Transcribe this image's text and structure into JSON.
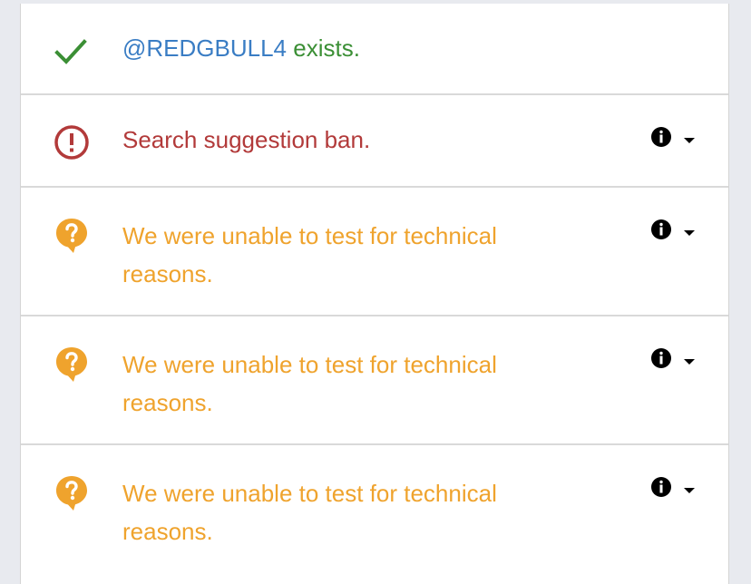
{
  "colors": {
    "success": "#3b8f35",
    "link": "#3a7dc4",
    "error": "#b23a3a",
    "warning": "#efa32d",
    "icon_dark": "#000000"
  },
  "results": [
    {
      "status": "success",
      "icon": "check-icon",
      "handle": "@REDGBULL4",
      "message": " exists.",
      "has_info": false
    },
    {
      "status": "error",
      "icon": "exclamation-circle-icon",
      "message": "Search suggestion ban.",
      "has_info": true
    },
    {
      "status": "warning",
      "icon": "question-bubble-icon",
      "message": "We were unable to test for technical reasons.",
      "has_info": true
    },
    {
      "status": "warning",
      "icon": "question-bubble-icon",
      "message": "We were unable to test for technical reasons.",
      "has_info": true
    },
    {
      "status": "warning",
      "icon": "question-bubble-icon",
      "message": "We were unable to test for technical reasons.",
      "has_info": true
    }
  ]
}
